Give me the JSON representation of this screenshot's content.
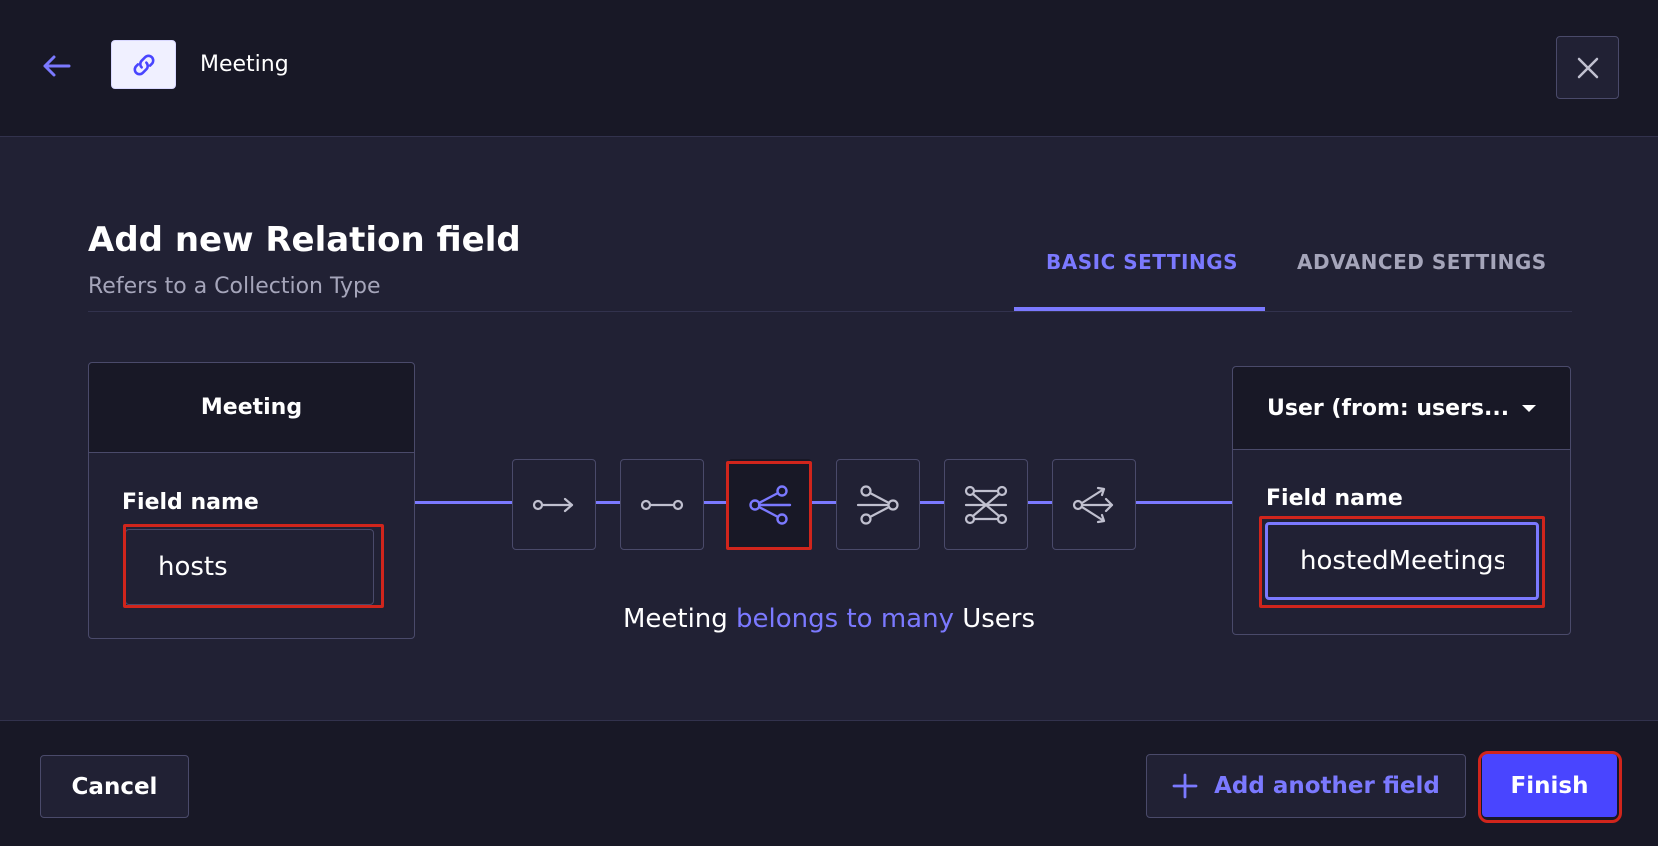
{
  "header": {
    "title": "Meeting",
    "back_icon": "arrow-left-icon",
    "link_icon": "link-icon",
    "close_icon": "close-icon"
  },
  "main": {
    "title": "Add new Relation field",
    "subtitle": "Refers to a Collection Type",
    "tabs": [
      {
        "label": "BASIC SETTINGS",
        "active": true
      },
      {
        "label": "ADVANCED SETTINGS",
        "active": false
      }
    ]
  },
  "left_card": {
    "title": "Meeting",
    "field_label": "Field name",
    "field_value": "hosts"
  },
  "right_card": {
    "dropdown_value": "User (from: users...",
    "field_label": "Field name",
    "field_value": "hostedMeetings"
  },
  "relation_types": [
    {
      "icon": "one-way-relation-icon",
      "selected": false
    },
    {
      "icon": "one-to-one-relation-icon",
      "selected": false
    },
    {
      "icon": "many-to-one-relation-icon",
      "selected": true
    },
    {
      "icon": "one-to-many-relation-icon",
      "selected": false
    },
    {
      "icon": "many-to-many-relation-icon",
      "selected": false
    },
    {
      "icon": "many-way-relation-icon",
      "selected": false
    }
  ],
  "relation_text": {
    "left": "Meeting",
    "middle": "belongs to many",
    "right": "Users"
  },
  "footer": {
    "cancel_label": "Cancel",
    "add_label": "Add another field",
    "finish_label": "Finish"
  },
  "colors": {
    "accent": "#7b79ff",
    "primary": "#4945ff",
    "highlight": "#d0251c",
    "background": "#212134",
    "header_bg": "#181826"
  }
}
